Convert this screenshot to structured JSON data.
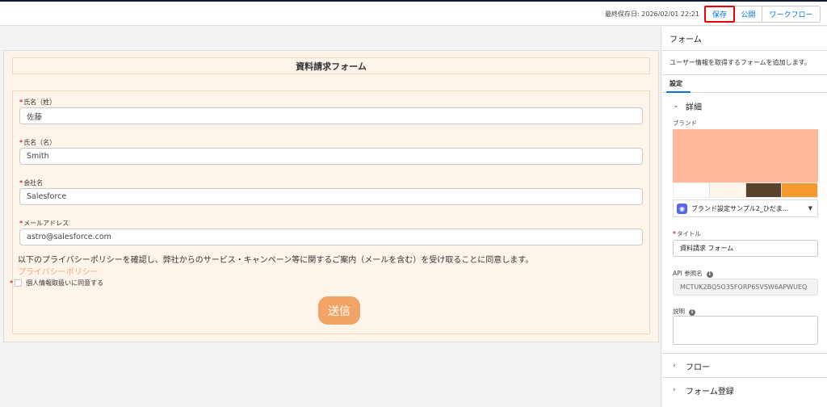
{
  "toolbar": {
    "last_saved": "最終保存日: 2026/02/01 22:21",
    "save_label": "保存",
    "publish_label": "公開",
    "workflow_label": "ワークフロー"
  },
  "form": {
    "title": "資料請求フォーム",
    "fields": [
      {
        "label": "氏名（姓）",
        "value": "佐藤"
      },
      {
        "label": "氏名（名）",
        "value": "Smith"
      },
      {
        "label": "会社名",
        "value": "Salesforce"
      },
      {
        "label": "メールアドレス",
        "value": "astro@salesforce.com"
      }
    ],
    "privacy_text": "以下のプライバシーポリシーを確認し、弊社からのサービス・キャンペーン等に関するご案内（メールを含む）を受け取ることに同意します。",
    "privacy_link": "プライバシーポリシー",
    "consent_label": "個人情報取扱いに同意する",
    "submit_label": "送信",
    "required_mark": "*"
  },
  "panel": {
    "header": "フォーム",
    "description": "ユーザー情報を取得するフォームを追加します。",
    "tab_settings": "設定",
    "details_section": "詳細",
    "brand_label": "ブランド",
    "brand_colors": {
      "main": "#ffb89a",
      "swatches": [
        "#ffffff",
        "#fdf4ea",
        "#5a412b",
        "#f29a2e",
        "#ffffff"
      ]
    },
    "brand_select_value": "ブランド設定サンプル2_ひだま...",
    "title_label": "タイトル",
    "title_value": "資料請求 フォーム",
    "api_label": "API 参照名",
    "api_value": "MCTUK2BQ5O35FORP6SVSW6APWUEQ",
    "description_label": "説明",
    "flow_section": "フロー",
    "registration_section": "フォーム登録"
  }
}
